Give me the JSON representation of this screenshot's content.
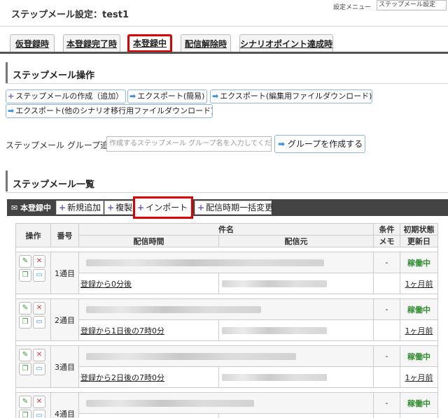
{
  "header": {
    "title": "ステップメール設定：test1",
    "settings_menu_label": "設定メニュー",
    "settings_menu_value": "ステップメール設定"
  },
  "tabs": [
    {
      "label": "仮登録時",
      "active": false
    },
    {
      "label": "本登録完了時",
      "active": false
    },
    {
      "label": "本登録中",
      "active": true
    },
    {
      "label": "配信解除時",
      "active": false
    },
    {
      "label": "シナリオポイント達成時",
      "active": false
    }
  ],
  "operations": {
    "heading": "ステップメール操作",
    "create_label": "ステップメールの作成（追加）",
    "export_simple_label": "エクスポート(簡易)",
    "export_edit_label": "エクスポート(編集用ファイルダウンロード)",
    "export_other_label": "エクスポート(他のシナリオ移行用ファイルダウンロード)"
  },
  "group": {
    "label": "ステップメール グループ追加",
    "placeholder": "作成するステップメール グループ名を入力してください",
    "create_button": "グループを作成する"
  },
  "list": {
    "heading": "ステップメール一覧",
    "toolbar_label": "本登録中",
    "add_label": "新規追加",
    "duplicate_label": "複製",
    "import_label": "インポート",
    "bulk_change_label": "配信時期一括変更"
  },
  "table": {
    "headers": {
      "operation": "操作",
      "number": "番号",
      "subject": "件名",
      "condition": "条件",
      "initial_status": "初期状態",
      "delivery_time": "配信時間",
      "sender": "配信元",
      "memo": "メモ",
      "updated": "更新日"
    },
    "rows": [
      {
        "number": "1通目",
        "timing": "登録から0分後",
        "condition": "-",
        "status": "稼働中",
        "updated": "1ヶ月前"
      },
      {
        "number": "2通目",
        "timing": "登録から1日後の7時0分",
        "condition": "-",
        "status": "稼働中",
        "updated": "1ヶ月前"
      },
      {
        "number": "3通目",
        "timing": "登録から2日後の7時0分",
        "condition": "-",
        "status": "稼働中",
        "updated": "1ヶ月前"
      },
      {
        "number": "4通目",
        "timing": "",
        "condition": "-",
        "status": "稼働中",
        "updated": ""
      }
    ]
  },
  "colors": {
    "highlight": "#e00000",
    "status_active": "#2e8b2e",
    "toolbar_bg": "#444444",
    "button_border": "#8fb7e0"
  }
}
